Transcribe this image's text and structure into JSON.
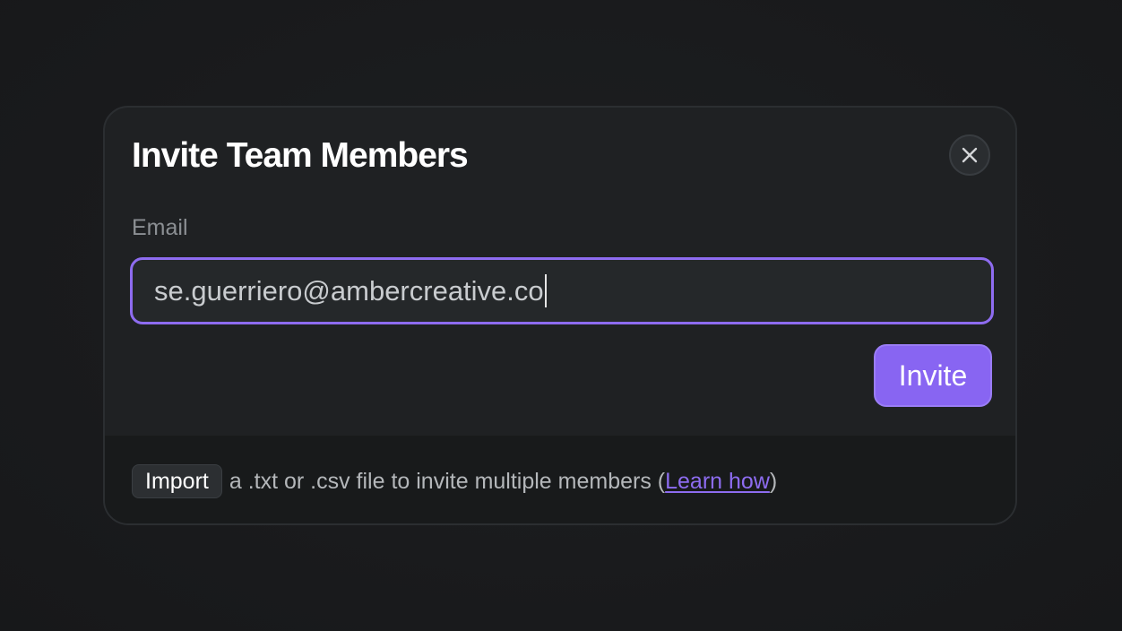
{
  "dialog": {
    "title": "Invite Team Members",
    "close_icon": "close-icon",
    "email_label": "Email",
    "email_value": "se.guerriero@ambercreative.co",
    "invite_label": "Invite"
  },
  "footer": {
    "import_label": "Import",
    "text": "a .txt or .csv file to invite multiple members (",
    "link_label": "Learn how",
    "close_paren": ")"
  },
  "colors": {
    "accent": "#8865f2",
    "link": "#8d6cf0",
    "modal_bg": "#1f2123",
    "footer_bg": "#181a1b",
    "page_bg": "#1a1c1e"
  }
}
